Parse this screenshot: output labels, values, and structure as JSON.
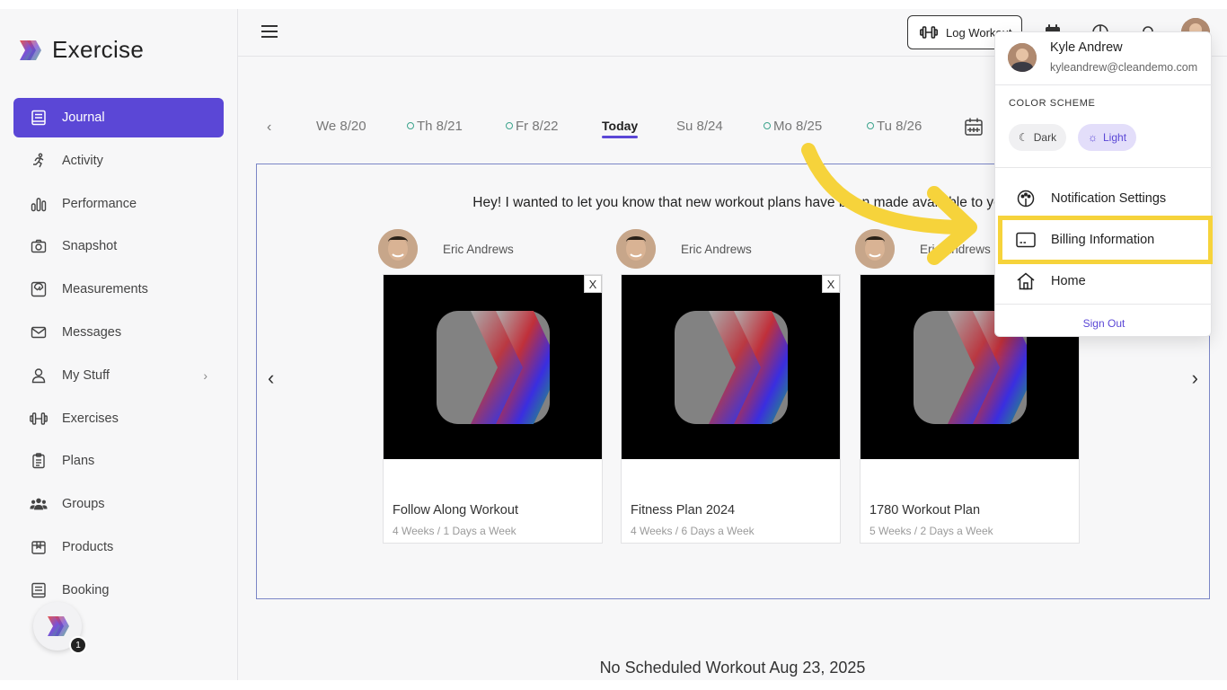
{
  "app": {
    "name": "Exercise"
  },
  "sidebar": {
    "items": [
      {
        "label": "Journal",
        "icon": "journal-icon",
        "active": true
      },
      {
        "label": "Activity",
        "icon": "running-icon"
      },
      {
        "label": "Performance",
        "icon": "bar-chart-icon"
      },
      {
        "label": "Snapshot",
        "icon": "camera-icon"
      },
      {
        "label": "Measurements",
        "icon": "scale-icon"
      },
      {
        "label": "Messages",
        "icon": "envelope-icon"
      },
      {
        "label": "My Stuff",
        "icon": "user-icon",
        "has_submenu": true
      },
      {
        "label": "Exercises",
        "icon": "dumbbell-icon"
      },
      {
        "label": "Plans",
        "icon": "clipboard-icon"
      },
      {
        "label": "Groups",
        "icon": "group-icon"
      },
      {
        "label": "Products",
        "icon": "box-icon"
      },
      {
        "label": "Booking",
        "icon": "book-icon"
      }
    ],
    "fab_badge": "1"
  },
  "topbar": {
    "log_workout_label": "Log Workout"
  },
  "dates": {
    "days": [
      {
        "label": "We 8/20",
        "dot": false
      },
      {
        "label": "Th 8/21",
        "dot": true
      },
      {
        "label": "Fr 8/22",
        "dot": true
      },
      {
        "label": "Today",
        "today": true
      },
      {
        "label": "Su 8/24",
        "dot": false
      },
      {
        "label": "Mo 8/25",
        "dot": true
      },
      {
        "label": "Tu 8/26",
        "dot": true
      }
    ]
  },
  "announcement": {
    "text": "Hey! I wanted to let you know that new workout plans have been made available to you.",
    "cards": [
      {
        "author": "Eric Andrews",
        "title": "Follow Along Workout",
        "subtitle": "4 Weeks / 1 Days a Week",
        "close": "X"
      },
      {
        "author": "Eric Andrews",
        "title": "Fitness Plan 2024",
        "subtitle": "4 Weeks / 6 Days a Week",
        "close": "X"
      },
      {
        "author": "Eric Andrews",
        "title": "1780 Workout Plan",
        "subtitle": "5 Weeks / 2 Days a Week",
        "close": ""
      }
    ]
  },
  "no_workout": "No Scheduled Workout Aug 23, 2025",
  "user_menu": {
    "name": "Kyle Andrew",
    "email": "kyleandrew@cleandemo.com",
    "color_scheme_label": "COLOR SCHEME",
    "dark_label": "Dark",
    "light_label": "Light",
    "selected_scheme": "Light",
    "items": [
      {
        "label": "Notification Settings",
        "icon": "palette-icon"
      },
      {
        "label": "Billing Information",
        "icon": "credit-card-icon",
        "highlighted": true
      },
      {
        "label": "Home",
        "icon": "home-icon"
      }
    ],
    "sign_out": "Sign Out"
  },
  "colors": {
    "accent": "#5b47d6",
    "highlight": "#f6d33b",
    "arrow": "#f6d33b"
  }
}
